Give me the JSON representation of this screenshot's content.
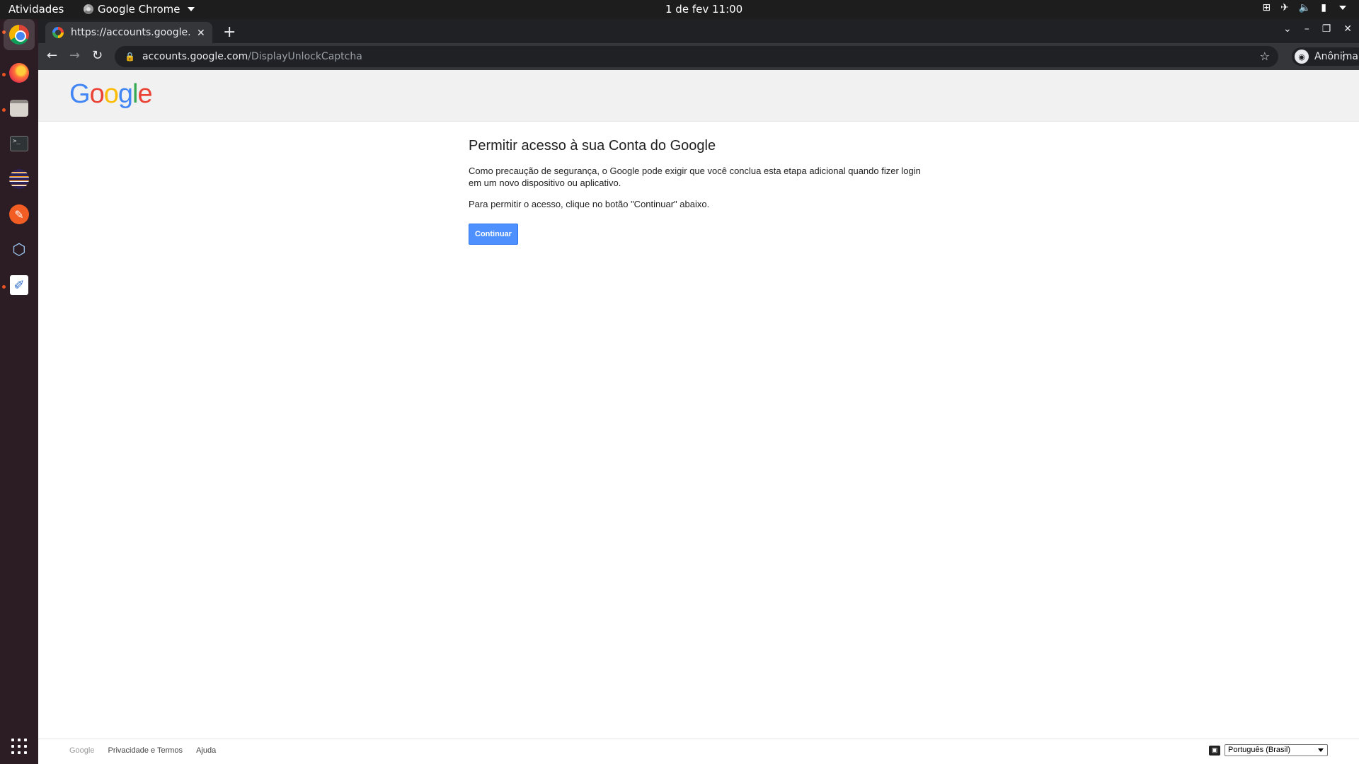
{
  "system_bar": {
    "activities": "Atividades",
    "app_menu": "Google Chrome",
    "clock": "1 de fev  11:00"
  },
  "dock": {
    "items": [
      "chrome-icon",
      "firefox-icon",
      "files-icon",
      "terminal-icon",
      "eclipse-icon",
      "inkscape-icon",
      "virtualbox-icon",
      "text-editor-icon",
      "show-apps-icon"
    ],
    "accent_color": "#e95420"
  },
  "browser": {
    "tab_title": "https://accounts.google.com/DisplayUnlockCaptcha",
    "url_host": "accounts.google.com",
    "url_path": "/DisplayUnlockCaptcha",
    "profile_label": "Anônima"
  },
  "page": {
    "title": "Permitir acesso à sua Conta do Google",
    "paragraph1": "Como precaução de segurança, o Google pode exigir que você conclua esta etapa adicional quando fizer login em um novo dispositivo ou aplicativo.",
    "paragraph2": "Para permitir o acesso, clique no botão \"Continuar\" abaixo.",
    "button_label": "Continuar",
    "button_color": "#4d90fe"
  },
  "footer": {
    "brand": "Google",
    "privacy_terms": "Privacidade e Termos",
    "help": "Ajuda",
    "language": "Português (Brasil)"
  }
}
